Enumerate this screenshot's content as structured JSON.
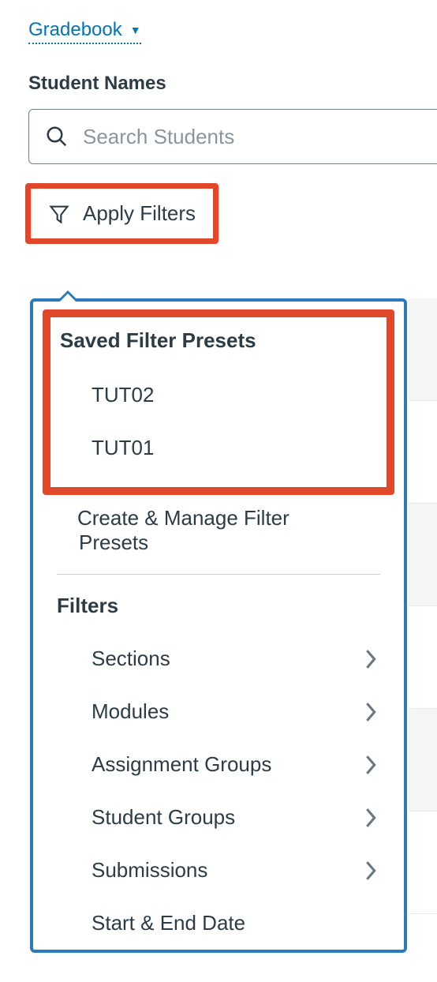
{
  "header": {
    "gradebook_label": "Gradebook"
  },
  "section": {
    "student_names_heading": "Student Names",
    "search_placeholder": "Search Students"
  },
  "filters_button": {
    "label": "Apply Filters"
  },
  "popover": {
    "saved_presets_heading": "Saved Filter Presets",
    "presets": [
      {
        "label": "TUT02"
      },
      {
        "label": "TUT01"
      }
    ],
    "manage_label": "Create & Manage Filter Presets",
    "filters_heading": "Filters",
    "categories": [
      {
        "label": "Sections",
        "has_chevron": true
      },
      {
        "label": "Modules",
        "has_chevron": true
      },
      {
        "label": "Assignment Groups",
        "has_chevron": true
      },
      {
        "label": "Student Groups",
        "has_chevron": true
      },
      {
        "label": "Submissions",
        "has_chevron": true
      },
      {
        "label": "Start & End Date",
        "has_chevron": false
      }
    ]
  }
}
